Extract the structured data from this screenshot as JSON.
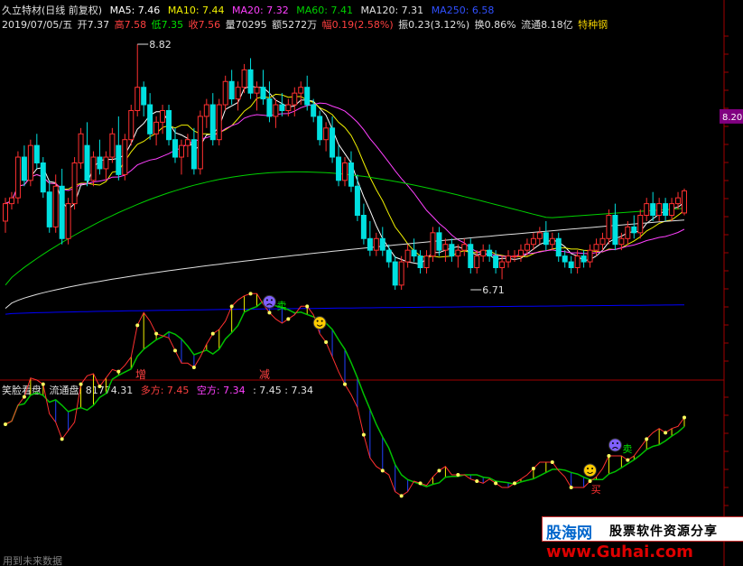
{
  "header": {
    "title": "久立特材(日线 前复权)",
    "ma5": "MA5: 7.46",
    "ma10": "MA10: 7.44",
    "ma20": "MA20: 7.32",
    "ma60": "MA60: 7.41",
    "ma120": "MA120: 7.31",
    "ma250": "MA250: 6.58",
    "date": "2019/07/05/五",
    "open": "开7.37",
    "high": "高7.58",
    "low": "低7.35",
    "close": "收7.56",
    "volume": "量70295",
    "amount": "额5272万",
    "change": "幅0.19(2.58%)",
    "amplitude": "振0.23(3.12%)",
    "turnover": "换0.86%",
    "float": "流通8.18亿",
    "sector": "特种钢"
  },
  "colors": {
    "up": "#ff3030",
    "down": "#00e0e0",
    "ma5": "#ffffff",
    "ma10": "#f0f000",
    "ma20": "#ff40ff",
    "ma60": "#00d000",
    "ma120": "#e0e0e0",
    "ma250": "#0000ff",
    "axis": "#a00000"
  },
  "indicator": {
    "title": "笑脸看盘",
    "float_label": "流通盘: 81774.31",
    "long_label": "多方: 7.45",
    "short_label": "空方: 7.34",
    "extra": ": 7.45 : 7.34",
    "sell_label": "卖",
    "buy_label": "买",
    "smile_icon": "smiley-face-icon",
    "frown_icon": "sad-face-icon"
  },
  "marks": {
    "zeng": "增",
    "jian": "减"
  },
  "footer": "用到未来数据",
  "watermark": {
    "logo": "股海网",
    "slogan": "股票软件资源分享",
    "url": "www.Guhai.com"
  },
  "chart_data": {
    "type": "candlestick",
    "title": "久立特材(日线 前复权)",
    "ylim": [
      6.5,
      9.0
    ],
    "yticks": [
      8.2
    ],
    "annotations": [
      {
        "label": "8.82",
        "value": 8.82,
        "bar": 21
      },
      {
        "label": "6.71",
        "value": 6.71,
        "bar": 74
      }
    ],
    "candles": [
      [
        7.3,
        7.5,
        7.2,
        7.45
      ],
      [
        7.45,
        7.55,
        7.4,
        7.5
      ],
      [
        7.5,
        7.9,
        7.45,
        7.85
      ],
      [
        7.85,
        7.95,
        7.6,
        7.65
      ],
      [
        7.65,
        8.0,
        7.6,
        7.95
      ],
      [
        7.95,
        8.05,
        7.75,
        7.8
      ],
      [
        7.8,
        7.85,
        7.5,
        7.55
      ],
      [
        7.55,
        7.65,
        7.2,
        7.25
      ],
      [
        7.25,
        7.7,
        7.2,
        7.6
      ],
      [
        7.6,
        7.75,
        7.1,
        7.15
      ],
      [
        7.15,
        7.5,
        7.1,
        7.45
      ],
      [
        7.45,
        7.85,
        7.4,
        7.8
      ],
      [
        7.8,
        8.1,
        7.75,
        8.05
      ],
      [
        7.95,
        8.15,
        7.6,
        7.65
      ],
      [
        7.65,
        7.9,
        7.6,
        7.85
      ],
      [
        7.85,
        8.0,
        7.7,
        7.75
      ],
      [
        7.75,
        7.9,
        7.65,
        7.85
      ],
      [
        7.85,
        8.1,
        7.8,
        8.05
      ],
      [
        7.95,
        8.2,
        7.65,
        7.7
      ],
      [
        7.7,
        8.05,
        7.65,
        8.0
      ],
      [
        8.0,
        8.3,
        7.95,
        8.25
      ],
      [
        8.25,
        8.82,
        8.2,
        8.45
      ],
      [
        8.45,
        8.5,
        8.2,
        8.3
      ],
      [
        8.3,
        8.4,
        8.0,
        8.05
      ],
      [
        8.05,
        8.2,
        7.95,
        8.15
      ],
      [
        8.15,
        8.3,
        8.05,
        8.25
      ],
      [
        8.25,
        8.3,
        7.95,
        8.0
      ],
      [
        8.0,
        8.1,
        7.8,
        7.85
      ],
      [
        7.85,
        8.0,
        7.7,
        7.95
      ],
      [
        7.95,
        8.05,
        7.85,
        8.0
      ],
      [
        8.0,
        8.1,
        7.7,
        7.75
      ],
      [
        7.75,
        8.25,
        7.7,
        8.2
      ],
      [
        8.2,
        8.35,
        8.1,
        8.3
      ],
      [
        8.3,
        8.4,
        7.95,
        8.0
      ],
      [
        8.0,
        8.35,
        7.95,
        8.3
      ],
      [
        8.3,
        8.55,
        8.25,
        8.5
      ],
      [
        8.5,
        8.6,
        8.3,
        8.35
      ],
      [
        8.35,
        8.5,
        8.25,
        8.45
      ],
      [
        8.45,
        8.65,
        8.4,
        8.6
      ],
      [
        8.6,
        8.7,
        8.35,
        8.4
      ],
      [
        8.4,
        8.5,
        8.25,
        8.45
      ],
      [
        8.45,
        8.6,
        8.3,
        8.35
      ],
      [
        8.35,
        8.5,
        8.15,
        8.2
      ],
      [
        8.2,
        8.35,
        8.1,
        8.3
      ],
      [
        8.3,
        8.4,
        8.2,
        8.25
      ],
      [
        8.25,
        8.35,
        8.2,
        8.3
      ],
      [
        8.3,
        8.45,
        8.2,
        8.4
      ],
      [
        8.4,
        8.5,
        8.3,
        8.45
      ],
      [
        8.45,
        8.55,
        8.25,
        8.3
      ],
      [
        8.3,
        8.35,
        8.15,
        8.2
      ],
      [
        8.2,
        8.25,
        7.95,
        8.0
      ],
      [
        8.0,
        8.15,
        7.9,
        8.1
      ],
      [
        8.1,
        8.2,
        7.8,
        7.85
      ],
      [
        7.85,
        7.95,
        7.6,
        7.65
      ],
      [
        7.65,
        7.85,
        7.6,
        7.8
      ],
      [
        7.8,
        7.9,
        7.55,
        7.6
      ],
      [
        7.6,
        7.7,
        7.3,
        7.35
      ],
      [
        7.35,
        7.45,
        7.1,
        7.15
      ],
      [
        7.15,
        7.3,
        7.0,
        7.05
      ],
      [
        7.05,
        7.2,
        7.0,
        7.15
      ],
      [
        7.15,
        7.25,
        7.0,
        7.05
      ],
      [
        7.05,
        7.1,
        6.9,
        6.95
      ],
      [
        6.95,
        7.0,
        6.71,
        6.75
      ],
      [
        6.75,
        7.0,
        6.71,
        6.95
      ],
      [
        6.95,
        7.1,
        6.9,
        7.05
      ],
      [
        7.05,
        7.15,
        6.95,
        7.0
      ],
      [
        7.0,
        7.05,
        6.85,
        6.9
      ],
      [
        6.9,
        7.05,
        6.85,
        7.0
      ],
      [
        7.0,
        7.25,
        6.95,
        7.2
      ],
      [
        7.2,
        7.25,
        7.0,
        7.05
      ],
      [
        7.05,
        7.15,
        6.95,
        7.1
      ],
      [
        7.1,
        7.15,
        6.95,
        7.0
      ],
      [
        7.0,
        7.1,
        6.9,
        7.05
      ],
      [
        7.05,
        7.15,
        7.0,
        7.1
      ],
      [
        7.1,
        7.15,
        6.85,
        6.9
      ],
      [
        6.9,
        7.05,
        6.85,
        7.0
      ],
      [
        7.0,
        7.1,
        6.95,
        7.05
      ],
      [
        7.05,
        7.1,
        6.95,
        7.0
      ],
      [
        7.0,
        7.05,
        6.85,
        6.9
      ],
      [
        6.9,
        7.0,
        6.8,
        6.95
      ],
      [
        6.95,
        7.05,
        6.9,
        7.0
      ],
      [
        7.0,
        7.05,
        6.95,
        7.0
      ],
      [
        7.0,
        7.1,
        6.95,
        7.05
      ],
      [
        7.05,
        7.15,
        7.0,
        7.1
      ],
      [
        7.1,
        7.2,
        7.05,
        7.15
      ],
      [
        7.15,
        7.25,
        7.1,
        7.2
      ],
      [
        7.2,
        7.3,
        7.05,
        7.1
      ],
      [
        7.1,
        7.2,
        7.05,
        7.15
      ],
      [
        7.15,
        7.2,
        6.95,
        7.0
      ],
      [
        7.0,
        7.05,
        6.9,
        6.95
      ],
      [
        6.95,
        7.0,
        6.85,
        6.9
      ],
      [
        6.9,
        7.05,
        6.85,
        7.0
      ],
      [
        7.0,
        7.05,
        6.9,
        6.95
      ],
      [
        6.95,
        7.1,
        6.9,
        7.05
      ],
      [
        7.05,
        7.15,
        7.0,
        7.1
      ],
      [
        7.1,
        7.2,
        7.05,
        7.15
      ],
      [
        7.15,
        7.4,
        7.1,
        7.35
      ],
      [
        7.35,
        7.45,
        7.05,
        7.1
      ],
      [
        7.1,
        7.2,
        7.05,
        7.15
      ],
      [
        7.15,
        7.3,
        7.1,
        7.25
      ],
      [
        7.25,
        7.35,
        7.15,
        7.2
      ],
      [
        7.2,
        7.4,
        7.15,
        7.35
      ],
      [
        7.35,
        7.5,
        7.3,
        7.45
      ],
      [
        7.45,
        7.55,
        7.3,
        7.35
      ],
      [
        7.35,
        7.5,
        7.3,
        7.45
      ],
      [
        7.45,
        7.5,
        7.3,
        7.35
      ],
      [
        7.35,
        7.5,
        7.3,
        7.45
      ],
      [
        7.45,
        7.55,
        7.4,
        7.5
      ],
      [
        7.37,
        7.58,
        7.35,
        7.56
      ]
    ],
    "series": [
      {
        "name": "MA5"
      },
      {
        "name": "MA10"
      },
      {
        "name": "MA20"
      },
      {
        "name": "MA60"
      },
      {
        "name": "MA120"
      },
      {
        "name": "MA250"
      }
    ]
  }
}
